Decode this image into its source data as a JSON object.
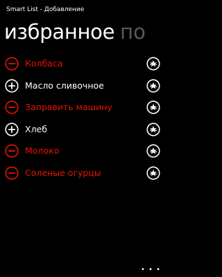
{
  "app": {
    "title": "Smart List - Добавление"
  },
  "pivot": {
    "active": "избранное",
    "next": "по"
  },
  "colors": {
    "removed": "#e51400",
    "normal": "#ffffff",
    "inactive_header": "#5a5a5a",
    "background": "#000000"
  },
  "items": [
    {
      "label": "Колбаса",
      "state": "remove",
      "state_icon": "minus-circle-icon",
      "fav_icon": "star-circle-icon"
    },
    {
      "label": "Масло сливочное",
      "state": "add",
      "state_icon": "plus-circle-icon",
      "fav_icon": "star-circle-icon"
    },
    {
      "label": "Заправить машину",
      "state": "remove",
      "state_icon": "minus-circle-icon",
      "fav_icon": "star-circle-icon"
    },
    {
      "label": "Хлеб",
      "state": "add",
      "state_icon": "plus-circle-icon",
      "fav_icon": "star-circle-icon"
    },
    {
      "label": "Молоко",
      "state": "remove",
      "state_icon": "minus-circle-icon",
      "fav_icon": "star-circle-icon"
    },
    {
      "label": "Соленые огурцы",
      "state": "remove",
      "state_icon": "minus-circle-icon",
      "fav_icon": "star-circle-icon"
    }
  ],
  "appbar": {
    "more_icon": "more-dots-icon",
    "more_label": "• • •"
  }
}
